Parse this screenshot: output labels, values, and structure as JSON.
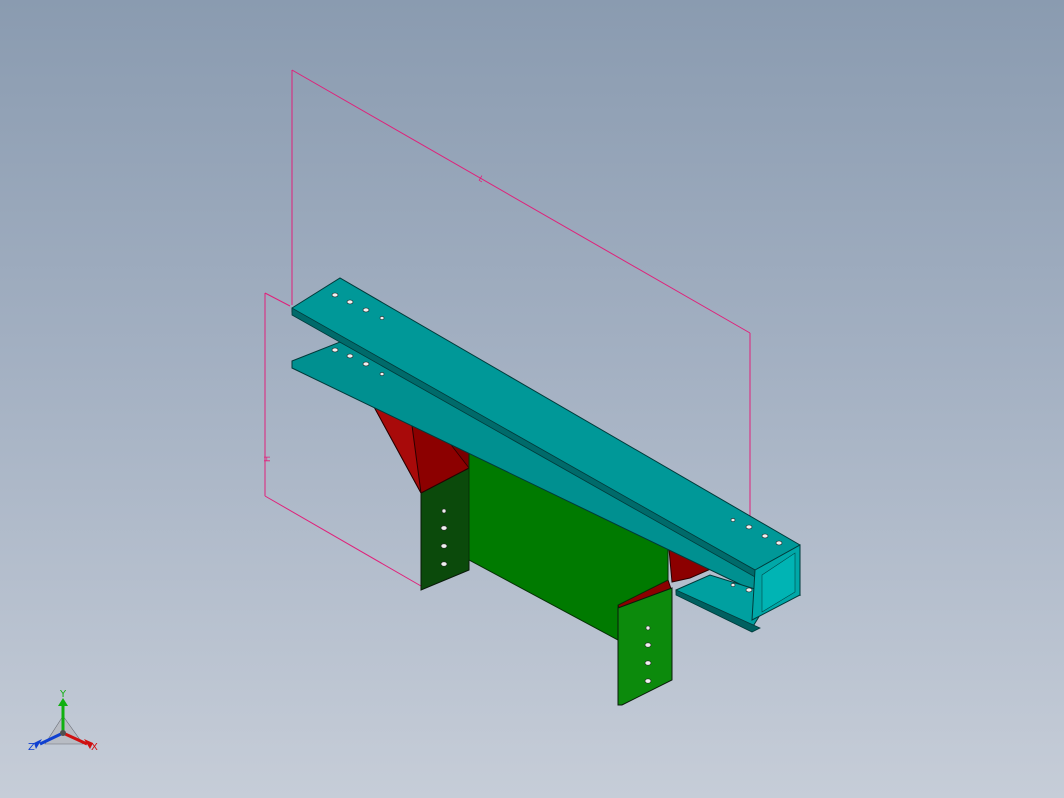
{
  "viewport": {
    "background_top": "#8a9bb0",
    "background_bottom": "#c6cdd8"
  },
  "model": {
    "tray_color": "#009090",
    "branch_color": "#007a00",
    "reducer_color": "#8c0000",
    "dimension_color": "#e0207a"
  },
  "dimensions": {
    "length_label": "L",
    "height_label": "H"
  },
  "triad": {
    "x_label": "X",
    "y_label": "Y",
    "z_label": "Z",
    "x_color": "#d01010",
    "y_color": "#10b010",
    "z_color": "#1040d0"
  }
}
